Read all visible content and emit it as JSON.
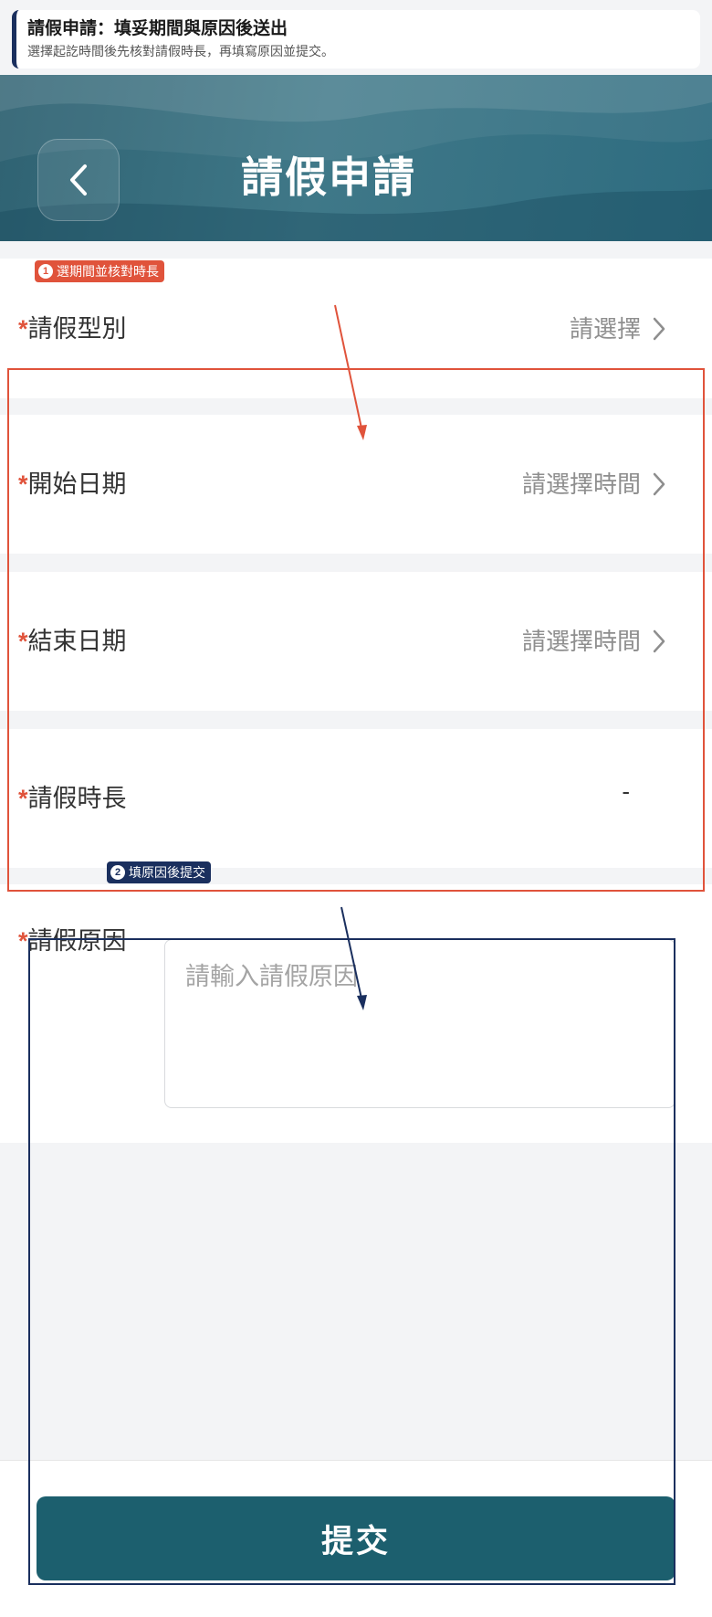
{
  "banner": {
    "title": "請假申請：填妥期間與原因後送出",
    "subtitle": "選擇起訖時間後先核對請假時長，再填寫原因並提交。"
  },
  "header": {
    "title": "請假申請",
    "back_icon": "chevron-left-icon"
  },
  "form": {
    "required_mark": "*",
    "leave_type": {
      "label": "請假型別",
      "value": "請選擇"
    },
    "start_date": {
      "label": "開始日期",
      "value": "請選擇時間"
    },
    "end_date": {
      "label": "結束日期",
      "value": "請選擇時間"
    },
    "duration": {
      "label": "請假時長",
      "value": "-"
    },
    "reason": {
      "label": "請假原因",
      "placeholder": "請輸入請假原因"
    }
  },
  "footer": {
    "submit_label": "提交"
  },
  "annotations": {
    "step1": {
      "number": "1",
      "text": "選期間並核對時長",
      "color": "#e0533b"
    },
    "step2": {
      "number": "2",
      "text": "填原因後提交",
      "color": "#1a2f5e"
    }
  },
  "colors": {
    "accent": "#1c5f6e",
    "required": "#e0533b",
    "header_bg": "#3a7484"
  }
}
